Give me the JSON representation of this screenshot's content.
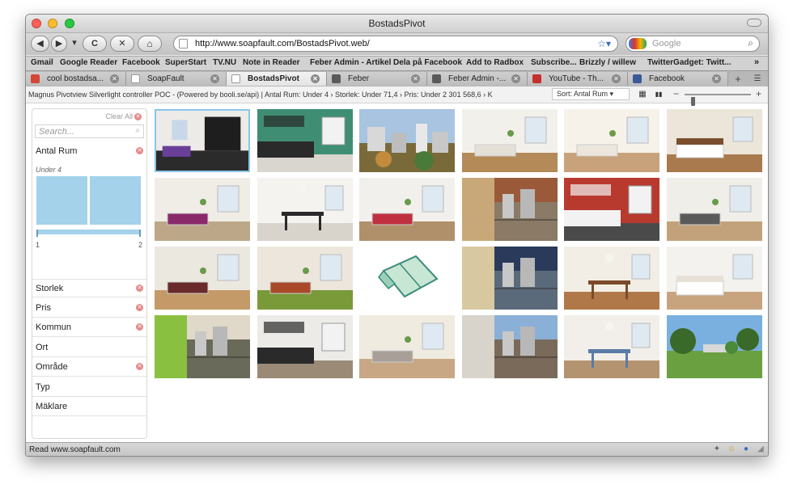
{
  "window": {
    "title": "BostadsPivot"
  },
  "toolbar": {
    "back": "◀",
    "forward": "▶",
    "menu": "▾",
    "reload": "C",
    "stop": "✕",
    "home": "⌂"
  },
  "url": {
    "value": "http://www.soapfault.com/BostadsPivot.web/"
  },
  "search": {
    "placeholder": "Google"
  },
  "bookmarks": [
    "Gmail",
    "Google Reader",
    "Facebook",
    "SuperStart",
    "TV.NU",
    "Note in Reader",
    "Feber Admin - Artikel",
    "Dela på Facebook",
    "Add to Radbox",
    "Subscribe...",
    "Brizzly / willew",
    "TwitterGadget: Twitt..."
  ],
  "bookmarks_overflow": "»",
  "tabs": [
    {
      "label": "cool bostadsa...",
      "icon_color": "#d44638",
      "icon": "mail-icon"
    },
    {
      "label": "SoapFault",
      "icon_color": "#ffffff",
      "icon": "page-icon"
    },
    {
      "label": "BostadsPivot",
      "icon_color": "#ffffff",
      "icon": "page-icon",
      "active": true
    },
    {
      "label": "Feber",
      "icon_color": "#5a5a5a",
      "icon": "feber-icon"
    },
    {
      "label": "Feber Admin -...",
      "icon_color": "#5a5a5a",
      "icon": "feber-admin-icon"
    },
    {
      "label": "YouTube - Th...",
      "icon_color": "#c4302b",
      "icon": "youtube-icon"
    },
    {
      "label": "Facebook",
      "icon_color": "#3b5998",
      "icon": "facebook-icon"
    }
  ],
  "tab_close": "✕",
  "tab_new": "+",
  "pivot": {
    "breadcrumb": "Magnus Pivotview Silverlight controller POC - (Powered by booli.se/api) | Antal Rum: Under 4 › Storlek: Under 71,4 › Pris: Under 2 301 568,6 › K",
    "sort_label": "Sort: Antal Rum ▾",
    "view_grid": "▦",
    "view_graph": "▮▮",
    "zoom_minus": "−",
    "zoom_plus": "+",
    "zoom_level": 0.1
  },
  "filters": {
    "clear_all": "Clear All",
    "search_placeholder": "Search...",
    "search_icon": "⌕",
    "antal_rum": {
      "label": "Antal Rum",
      "sub": "Under 4",
      "min_label": "1",
      "max_label": "2",
      "bars": [
        1,
        1
      ]
    },
    "facets": [
      {
        "label": "Storlek",
        "clearable": true
      },
      {
        "label": "Pris",
        "clearable": true
      },
      {
        "label": "Kommun",
        "clearable": true
      },
      {
        "label": "Ort",
        "clearable": false
      },
      {
        "label": "Område",
        "clearable": true
      },
      {
        "label": "Typ",
        "clearable": false
      },
      {
        "label": "Mäklare",
        "clearable": false
      }
    ],
    "close_glyph": "✕"
  },
  "photos": [
    {
      "kind": "dark-living",
      "wall": "#ecebe8",
      "floor": "#2b2b2b",
      "accent": "#6a3f9a"
    },
    {
      "kind": "kitchen",
      "wall": "#3f8e74",
      "floor": "#d9d6cf",
      "accent": "#2a2a2a"
    },
    {
      "kind": "city",
      "wall": "#a8c4e0",
      "floor": "#7a6a3a",
      "accent": "#c28a3c"
    },
    {
      "kind": "living",
      "wall": "#f2f0ea",
      "floor": "#b48a58",
      "accent": "#e4e0d8"
    },
    {
      "kind": "living",
      "wall": "#f6f2ea",
      "floor": "#c8a27a",
      "accent": "#ece6dc"
    },
    {
      "kind": "bedroom",
      "wall": "#ece6da",
      "floor": "#a87a4e",
      "accent": "#7a4e2e"
    },
    {
      "kind": "living",
      "wall": "#f0ede6",
      "floor": "#bca888",
      "accent": "#8a2a6a"
    },
    {
      "kind": "dining",
      "wall": "#f4f3f0",
      "floor": "#d8d4cc",
      "accent": "#2a2a2a"
    },
    {
      "kind": "living",
      "wall": "#f2f0ec",
      "floor": "#b0906a",
      "accent": "#c03040"
    },
    {
      "kind": "balcony",
      "wall": "#9a5a3a",
      "floor": "#8a7a66",
      "accent": "#c8a878"
    },
    {
      "kind": "kitchen",
      "wall": "#b83a2e",
      "floor": "#4a4a4a",
      "accent": "#f2f2f2"
    },
    {
      "kind": "living",
      "wall": "#f0eee8",
      "floor": "#c2a27a",
      "accent": "#5a5a5a"
    },
    {
      "kind": "living",
      "wall": "#ebe8e0",
      "floor": "#c49a68",
      "accent": "#6a2a2a"
    },
    {
      "kind": "living",
      "wall": "#ede6dc",
      "floor": "#7a9a3a",
      "accent": "#a84a2a"
    },
    {
      "kind": "floorplan",
      "wall": "#ffffff",
      "floor": "#c8e6d4",
      "accent": "#3a8a7a"
    },
    {
      "kind": "balcony",
      "wall": "#2a3a5a",
      "floor": "#5a6a7a",
      "accent": "#d8c8a0"
    },
    {
      "kind": "dining",
      "wall": "#f2eee6",
      "floor": "#b07848",
      "accent": "#7a4a2a"
    },
    {
      "kind": "bedroom",
      "wall": "#f4f2ee",
      "floor": "#c8a47e",
      "accent": "#e6e0d6"
    },
    {
      "kind": "balcony",
      "wall": "#e0d8c8",
      "floor": "#6a6a5a",
      "accent": "#8ac040"
    },
    {
      "kind": "kitchen",
      "wall": "#ecebe8",
      "floor": "#9a8a76",
      "accent": "#2a2a2a"
    },
    {
      "kind": "living",
      "wall": "#f0ebe0",
      "floor": "#c8a884",
      "accent": "#a8a098"
    },
    {
      "kind": "balcony",
      "wall": "#8ab0d8",
      "floor": "#7a6a5a",
      "accent": "#d8d4cc"
    },
    {
      "kind": "dining",
      "wall": "#f2efea",
      "floor": "#b49470",
      "accent": "#5a7aa8"
    },
    {
      "kind": "garden",
      "wall": "#7ab0e0",
      "floor": "#6aa040",
      "accent": "#3a6a2a"
    }
  ],
  "status": {
    "text": "Read www.soapfault.com"
  }
}
